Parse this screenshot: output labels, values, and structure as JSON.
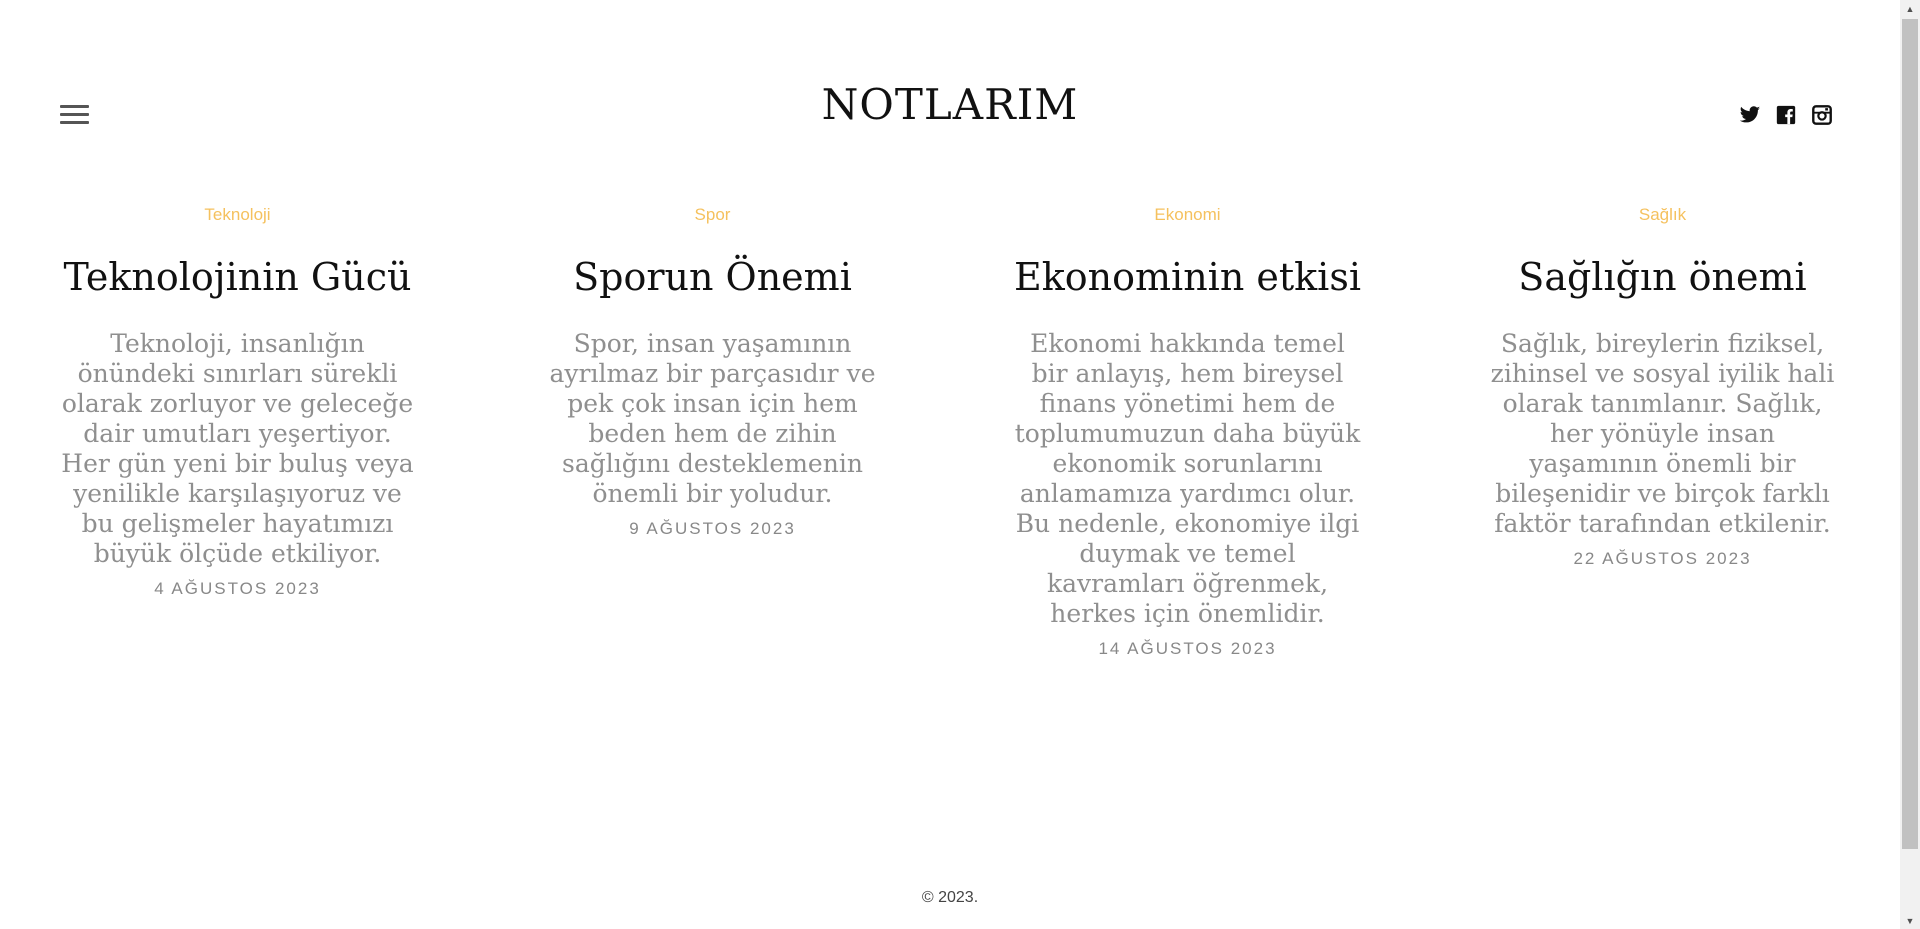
{
  "header": {
    "title": "NOTLARIM",
    "menu_icon": "hamburger-menu-icon",
    "socials": [
      {
        "name": "twitter-icon"
      },
      {
        "name": "facebook-icon"
      },
      {
        "name": "instagram-icon"
      }
    ]
  },
  "articles": [
    {
      "category": "Teknoloji",
      "title": "Teknolojinin Gücü",
      "excerpt": "Teknoloji, insanlığın önündeki sınırları sürekli olarak zorluyor ve geleceğe dair umutları yeşertiyor. Her gün yeni bir buluş veya yenilikle karşılaşıyoruz ve bu gelişmeler hayatımızı büyük ölçüde etkiliyor.",
      "date": "4 AĞUSTOS 2023"
    },
    {
      "category": "Spor",
      "title": "Sporun Önemi",
      "excerpt": "Spor, insan yaşamının ayrılmaz bir parçasıdır ve pek çok insan için hem beden hem de zihin sağlığını desteklemenin önemli bir yoludur.",
      "date": "9 AĞUSTOS 2023"
    },
    {
      "category": "Ekonomi",
      "title": "Ekonominin etkisi",
      "excerpt": "Ekonomi hakkında temel bir anlayış, hem bireysel finans yönetimi hem de toplumumuzun daha büyük ekonomik sorunlarını anlamamıza yardımcı olur. Bu nedenle, ekonomiye ilgi duymak ve temel kavramları öğrenmek, herkes için önemlidir.",
      "date": "14 AĞUSTOS 2023"
    },
    {
      "category": "Sağlık",
      "title": "Sağlığın önemi",
      "excerpt": "Sağlık, bireylerin fiziksel, zihinsel ve sosyal iyilik hali olarak tanımlanır. Sağlık, her yönüyle insan yaşamının önemli bir bileşenidir ve birçok farklı faktör tarafından etkilenir.",
      "date": "22 AĞUSTOS 2023"
    }
  ],
  "footer": {
    "copyright": "© 2023."
  },
  "colors": {
    "accent": "#f5c15e",
    "title": "#111111",
    "excerpt": "#8f8f8f",
    "date": "#888888"
  }
}
